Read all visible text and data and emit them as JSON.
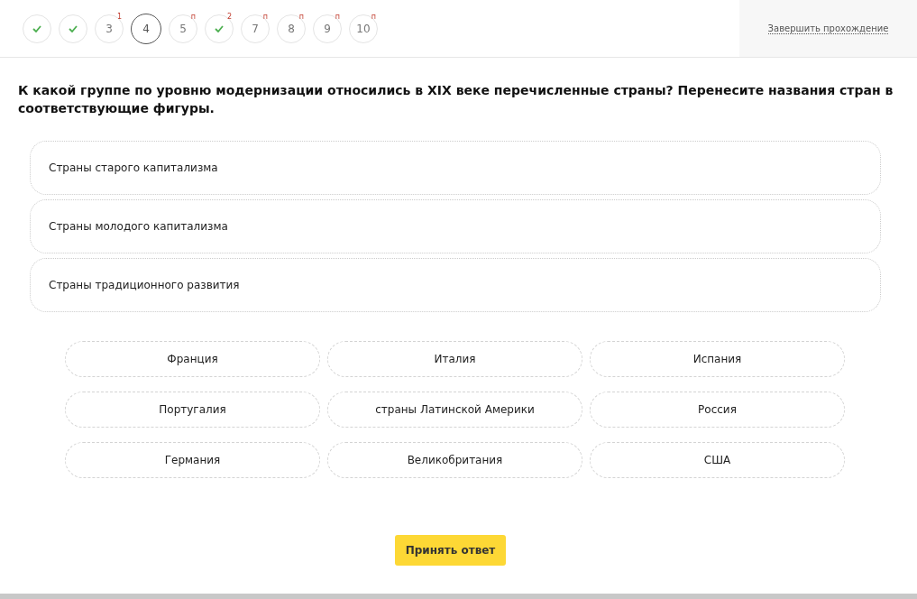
{
  "steps": [
    {
      "kind": "done",
      "selected": false
    },
    {
      "kind": "done",
      "selected": false
    },
    {
      "kind": "number",
      "label": "3",
      "mark": "1",
      "selected": false
    },
    {
      "kind": "number",
      "label": "4",
      "selected": true
    },
    {
      "kind": "number",
      "label": "5",
      "mark": "п",
      "selected": false
    },
    {
      "kind": "done",
      "mark": "2",
      "selected": false
    },
    {
      "kind": "number",
      "label": "7",
      "mark": "п",
      "selected": false
    },
    {
      "kind": "number",
      "label": "8",
      "mark": "п",
      "selected": false
    },
    {
      "kind": "number",
      "label": "9",
      "mark": "п",
      "selected": false
    },
    {
      "kind": "number",
      "label": "10",
      "mark": "п",
      "selected": false
    }
  ],
  "finish_link": "Завершить прохождение",
  "question": "К какой группе по уровню модернизации относились в XIX веке перечисленные страны? Перенесите названия стран в соответствующие фигуры.",
  "drop_zones": [
    "Страны старого капитализма",
    "Страны молодого капитализма",
    "Страны традиционного развития"
  ],
  "options": [
    "Франция",
    "Италия",
    "Испания",
    "Португалия",
    "страны Латинской Америки",
    "Россия",
    "Германия",
    "Великобритания",
    "США"
  ],
  "submit_button": "Принять ответ"
}
